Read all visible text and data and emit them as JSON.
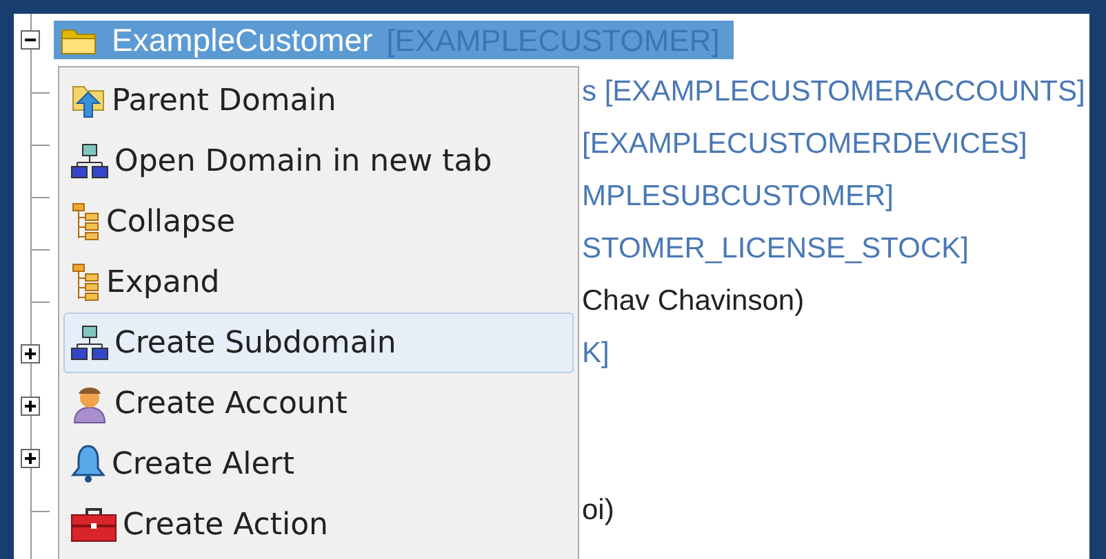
{
  "tree": {
    "root": {
      "label": "ExampleCustomer",
      "code": "[EXAMPLECUSTOMER]",
      "expanded": true,
      "selected": true
    },
    "children": [
      {
        "kind": "leaf",
        "text": "s [EXAMPLECUSTOMERACCOUNTS]",
        "is_code": true
      },
      {
        "kind": "leaf",
        "text": "[EXAMPLECUSTOMERDEVICES]",
        "is_code": true
      },
      {
        "kind": "leaf",
        "text": "MPLESUBCUSTOMER]",
        "is_code": true
      },
      {
        "kind": "leaf",
        "text": "STOMER_LICENSE_STOCK]",
        "is_code": true
      },
      {
        "kind": "leaf",
        "text": "Chav Chavinson)",
        "is_code": false
      },
      {
        "kind": "branch",
        "expanded": false,
        "text": "K]",
        "is_code": true
      },
      {
        "kind": "branch",
        "expanded": false
      },
      {
        "kind": "branch",
        "expanded": false
      },
      {
        "kind": "leaf",
        "text": "oi)",
        "is_code": false
      }
    ]
  },
  "context_menu": {
    "items": [
      {
        "kind": "parent",
        "label": "Parent Domain",
        "selected": false
      },
      {
        "kind": "network",
        "label": "Open Domain in new tab",
        "selected": false
      },
      {
        "kind": "tree",
        "label": "Collapse",
        "selected": false
      },
      {
        "kind": "tree",
        "label": "Expand",
        "selected": false
      },
      {
        "kind": "network",
        "label": "Create Subdomain",
        "selected": true
      },
      {
        "kind": "person",
        "label": "Create Account",
        "selected": false
      },
      {
        "kind": "bell",
        "label": "Create Alert",
        "selected": false
      },
      {
        "kind": "toolbox",
        "label": "Create Action",
        "selected": false
      }
    ]
  }
}
